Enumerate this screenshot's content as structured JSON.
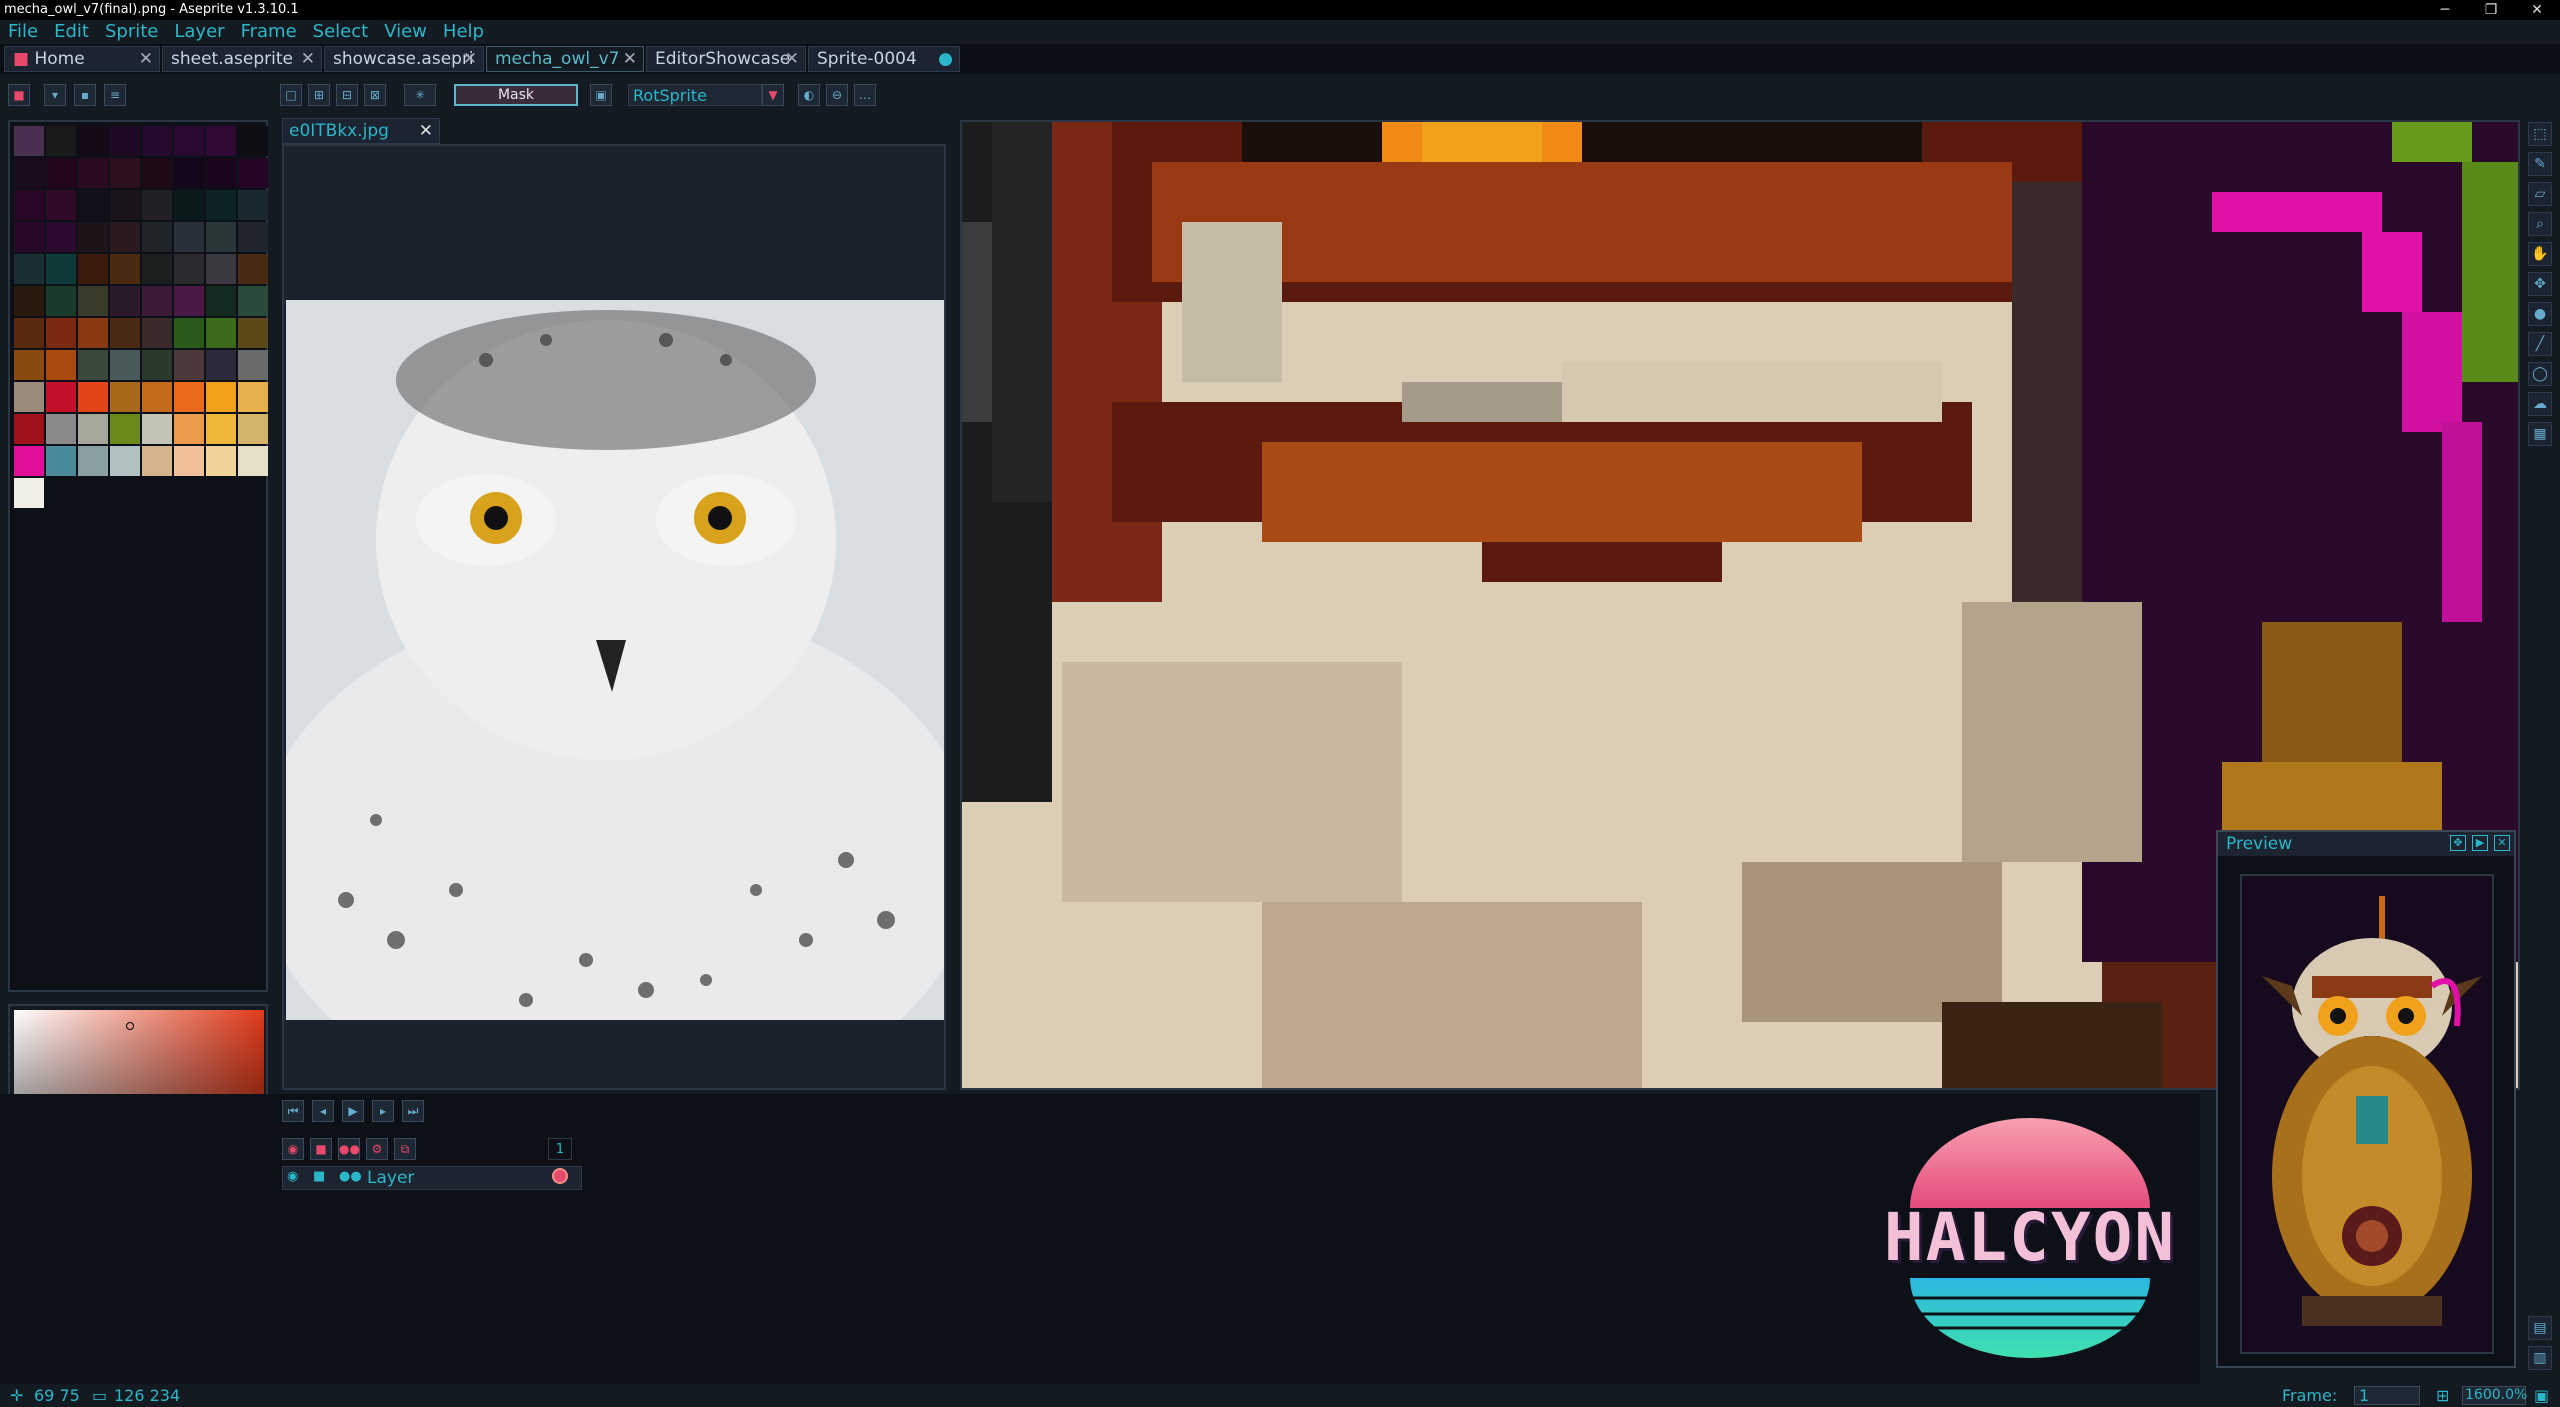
{
  "window": {
    "title": "mecha_owl_v7(final).png - Aseprite v1.3.10.1"
  },
  "menu": [
    "File",
    "Edit",
    "Sprite",
    "Layer",
    "Frame",
    "Select",
    "View",
    "Help"
  ],
  "tabs": [
    {
      "label": "Home",
      "active": false
    },
    {
      "label": "sheet.aseprite",
      "active": false
    },
    {
      "label": "showcase.asepri",
      "active": false
    },
    {
      "label": "mecha_owl_v7",
      "active": true
    },
    {
      "label": "EditorShowcase",
      "active": false
    },
    {
      "label": "Sprite-0004",
      "active": false
    }
  ],
  "toolbar": {
    "mask_label": "Mask",
    "algorithm": "RotSprite"
  },
  "reference": {
    "tab_label": "e0ITBkx.jpg",
    "subject": "snowy owl photo"
  },
  "palette": {
    "swatches": [
      "#4a3050",
      "#1a1a1a",
      "#140a18",
      "#1e0a24",
      "#240a2c",
      "#2a0a30",
      "#300a34",
      "#100c14",
      "#1a0c1e",
      "#22061e",
      "#2a0a20",
      "#2c1020",
      "#1c0a14",
      "#14061a",
      "#1a061c",
      "#220624",
      "#2a0626",
      "#300a28",
      "#14101a",
      "#1a141a",
      "#222024",
      "#0a1a1a",
      "#0e2424",
      "#1a2830",
      "#260828",
      "#2c0a30",
      "#1c1418",
      "#2a1a20",
      "#1e2428",
      "#28303a",
      "#2a3638",
      "#20262c",
      "#1a2e34",
      "#0e3a3a",
      "#3a1a0a",
      "#4a2a10",
      "#1a2020",
      "#2a2a2e",
      "#3a3a40",
      "#4a2a14",
      "#2a1a0e",
      "#1a3a2a",
      "#3a3a2a",
      "#2a1a2a",
      "#3a1a34",
      "#4a1a44",
      "#142a20",
      "#2a4a3a",
      "#5a2a10",
      "#7a2a10",
      "#8a3a10",
      "#4a2a10",
      "#3a2a2a",
      "#2a5a1a",
      "#3a6a1a",
      "#5a4a1a",
      "#8a4a10",
      "#aa4a10",
      "#3a4a3a",
      "#4a5a5a",
      "#2a3a2a",
      "#4a3a3a",
      "#2a2a3a",
      "#6a6a6a",
      "#9a8a7a",
      "#c4102a",
      "#e4441a",
      "#a86a1a",
      "#c46a1a",
      "#ea6a1a",
      "#f0a01a",
      "#e6b04a",
      "#a0101a",
      "#8a8a8a",
      "#a6a69a",
      "#6a8a1a",
      "#c4c4b4",
      "#ea9a4a",
      "#f0b63a",
      "#d4b46a",
      "#e0109a",
      "#4a8a9a",
      "#8aa0a0",
      "#b0c0c0",
      "#d4b48a",
      "#f0c09a",
      "#f0d49a",
      "#e6e0c8",
      "#f0f0e6"
    ],
    "fg_hex": "#F09383",
    "bg_hex": "#F09383"
  },
  "timeline": {
    "frame_number": "1",
    "layer_name": "Layer"
  },
  "preview": {
    "title": "Preview"
  },
  "status": {
    "cursor": "69  75",
    "size": "126  234",
    "frame_label": "Frame:",
    "frame_value": "1",
    "zoom": "1600.0%"
  },
  "logo": {
    "text": "HALCYON"
  },
  "colors": {
    "accent": "#2ab7c9",
    "fg": "#F09383"
  }
}
